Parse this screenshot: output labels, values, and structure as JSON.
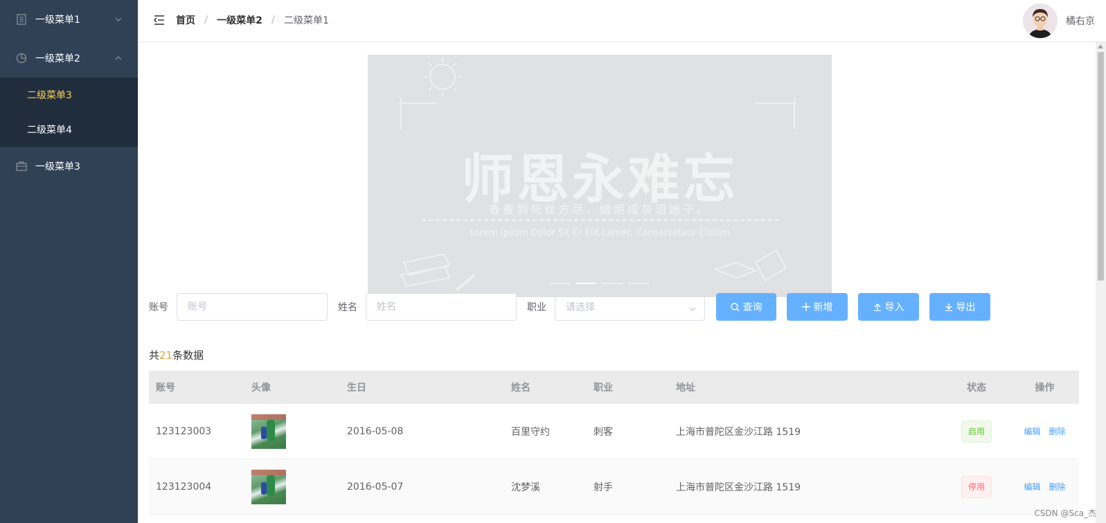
{
  "sidebar": {
    "menu1": "一级菜单1",
    "menu2": "一级菜单2",
    "menu2_children": [
      "二级菜单3",
      "二级菜单4"
    ],
    "menu3": "一级菜单3"
  },
  "header": {
    "breadcrumb": [
      "首页",
      "一级菜单2",
      "二级菜单1"
    ],
    "separator": "/",
    "username": "橘右京"
  },
  "banner": {
    "title": "师恩永难忘",
    "subtitle": "春蚕到死丝方尽，蜡炬成灰泪始干。",
    "lorem": "Lorem Ipsum Dolor Sit Er Elit Lamet, Consectetaur Cillium",
    "slide_count": 4,
    "active_slide": 2
  },
  "filter": {
    "account_label": "账号",
    "account_placeholder": "账号",
    "name_label": "姓名",
    "name_placeholder": "姓名",
    "job_label": "职业",
    "job_placeholder": "请选择",
    "btn_query": "查询",
    "btn_add": "新增",
    "btn_import": "导入",
    "btn_export": "导出"
  },
  "summary": {
    "prefix": "共",
    "count": "21",
    "suffix": "条数据"
  },
  "table": {
    "headers": [
      "账号",
      "头像",
      "生日",
      "姓名",
      "职业",
      "地址",
      "状态",
      "操作"
    ],
    "rows": [
      {
        "account": "123123003",
        "birthday": "2016-05-08",
        "name": "百里守约",
        "job": "刺客",
        "address": "上海市普陀区金沙江路 1519",
        "status": "启用",
        "edit": "编辑",
        "delete": "删除"
      },
      {
        "account": "123123004",
        "birthday": "2016-05-07",
        "name": "沈梦溪",
        "job": "射手",
        "address": "上海市普陀区金沙江路 1519",
        "status": "停用",
        "edit": "编辑",
        "delete": "删除"
      }
    ]
  },
  "watermark": "CSDN @Sca_杰",
  "colors": {
    "sidebar_bg": "#304156",
    "submenu_bg": "#1f2d3d",
    "active_text": "#ffd04b",
    "primary_button": "#66b1ff",
    "link": "#409eff"
  }
}
